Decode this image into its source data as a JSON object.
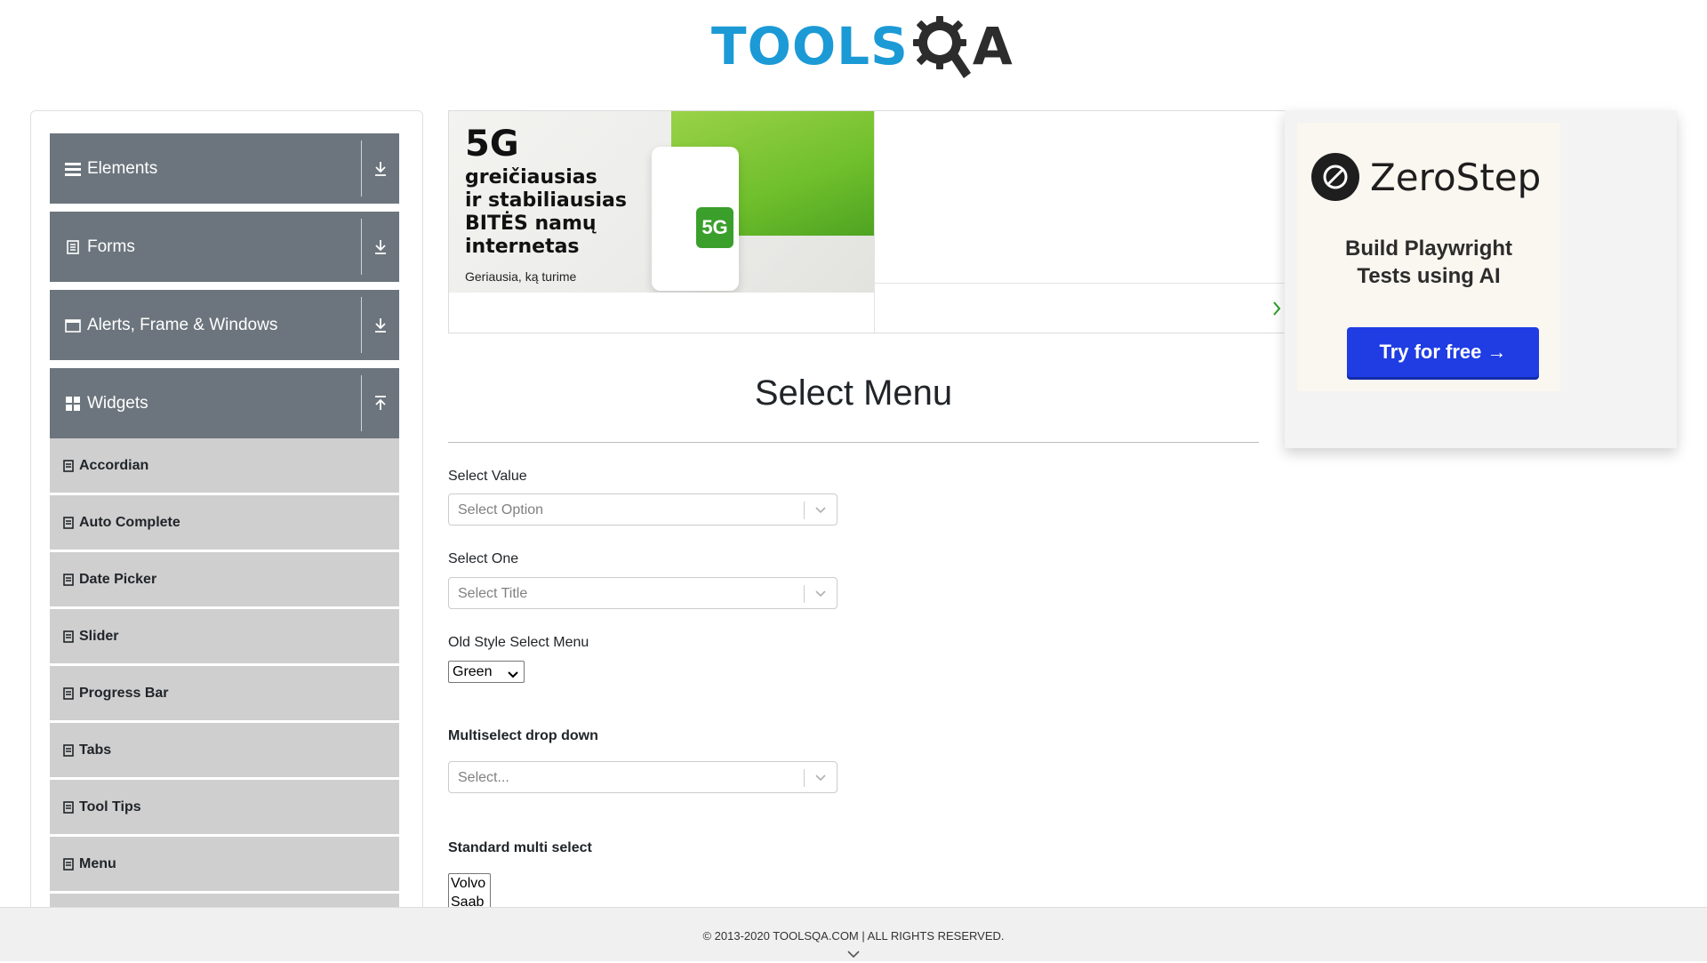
{
  "header": {
    "logo_tools": "TOOLS",
    "logo_qa": "A"
  },
  "sidebar": {
    "groups": [
      {
        "label": "Elements",
        "icon": "hamburger-icon",
        "expanded": false
      },
      {
        "label": "Forms",
        "icon": "document-icon",
        "expanded": false
      },
      {
        "label": "Alerts, Frame & Windows",
        "icon": "window-icon",
        "expanded": false
      },
      {
        "label": "Widgets",
        "icon": "grid-icon",
        "expanded": true
      }
    ],
    "widget_items": [
      "Accordian",
      "Auto Complete",
      "Date Picker",
      "Slider",
      "Progress Bar",
      "Tabs",
      "Tool Tips",
      "Menu"
    ]
  },
  "ad": {
    "headline": "5G",
    "lines": [
      "greičiausias",
      "ir stabiliausias",
      "BITĖS namų",
      "internetas"
    ],
    "small": "Geriausia, ką turime",
    "badge": "5G"
  },
  "side_ad": {
    "brand": "ZeroStep",
    "tagline_1": "Build Playwright",
    "tagline_2": "Tests using AI",
    "cta": "Try for free →"
  },
  "main": {
    "title": "Select Menu",
    "select_value_label": "Select Value",
    "select_value_placeholder": "Select Option",
    "select_one_label": "Select One",
    "select_one_placeholder": "Select Title",
    "old_style_label": "Old Style Select Menu",
    "old_style_value": "Green",
    "multiselect_label": "Multiselect drop down",
    "multiselect_placeholder": "Select...",
    "standard_multi_label": "Standard multi select",
    "standard_multi_options": [
      "Volvo",
      "Saab"
    ]
  },
  "footer": {
    "copyright": "© 2013-2020 TOOLSQA.COM | ALL RIGHTS RESERVED."
  },
  "colors": {
    "sidebar_group": "#6c757d",
    "sidebar_item": "#cfcfcf",
    "logo_blue": "#1b9ad6",
    "cta_blue": "#1f3de3"
  }
}
